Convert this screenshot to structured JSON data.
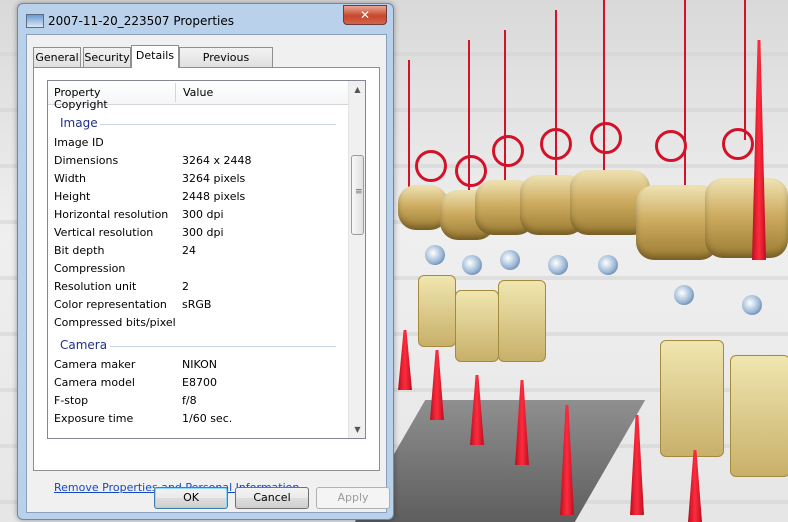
{
  "window": {
    "title": "2007-11-20_223507 Properties",
    "close_label": "✕"
  },
  "tabs": [
    {
      "label": "General"
    },
    {
      "label": "Security"
    },
    {
      "label": "Details",
      "active": true
    },
    {
      "label": "Previous Versions"
    }
  ],
  "list": {
    "header": {
      "property": "Property",
      "value": "Value"
    },
    "partial_top_row": "Copyright",
    "groups": {
      "image": "Image",
      "camera": "Camera"
    },
    "image_rows": [
      {
        "property": "Image ID",
        "value": ""
      },
      {
        "property": "Dimensions",
        "value": "3264 x 2448"
      },
      {
        "property": "Width",
        "value": "3264 pixels"
      },
      {
        "property": "Height",
        "value": "2448 pixels"
      },
      {
        "property": "Horizontal resolution",
        "value": "300 dpi"
      },
      {
        "property": "Vertical resolution",
        "value": "300 dpi"
      },
      {
        "property": "Bit depth",
        "value": "24"
      },
      {
        "property": "Compression",
        "value": ""
      },
      {
        "property": "Resolution unit",
        "value": "2"
      },
      {
        "property": "Color representation",
        "value": "sRGB"
      },
      {
        "property": "Compressed bits/pixel",
        "value": ""
      }
    ],
    "camera_rows": [
      {
        "property": "Camera maker",
        "value": "NIKON"
      },
      {
        "property": "Camera model",
        "value": "E8700"
      },
      {
        "property": "F-stop",
        "value": "f/8"
      },
      {
        "property": "Exposure time",
        "value": "1/60 sec."
      }
    ]
  },
  "remove_link": "Remove Properties and Personal Information",
  "buttons": {
    "ok": "OK",
    "cancel": "Cancel",
    "apply": "Apply"
  }
}
